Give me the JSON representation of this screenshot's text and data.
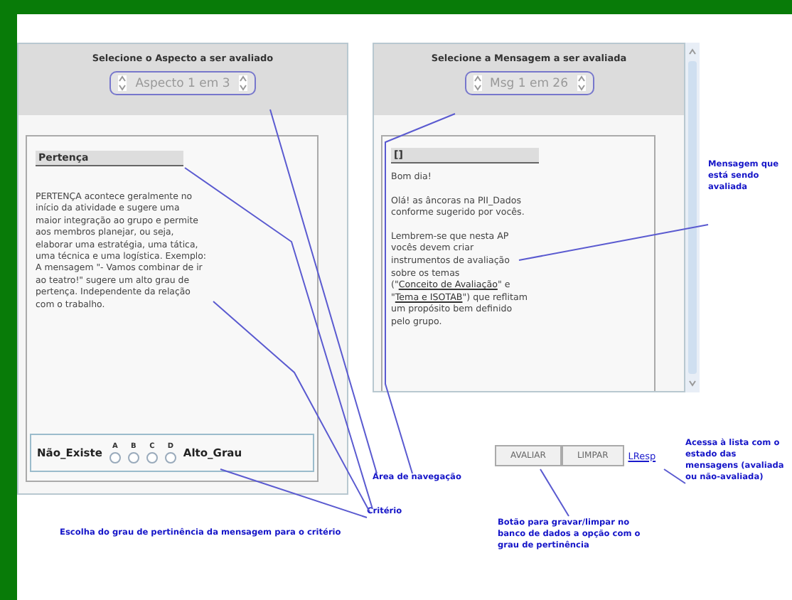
{
  "aspect_panel": {
    "heading": "Selecione o Aspecto a ser avaliado",
    "spinner": {
      "value": "Aspecto 1 em 3"
    },
    "criterion": {
      "title": "Pertença",
      "description": "PERTENÇA acontece geralmente no início da atividade e sugere uma maior integração ao grupo e permite aos membros planejar, ou seja, elaborar uma estratégia, uma tática, uma técnica e uma logística. Exemplo: A mensagem \"- Vamos combinar de ir ao teatro!\" sugere um alto grau de pertença. Independente da relação com o trabalho."
    },
    "scale": {
      "low_label": "Não_Existe",
      "high_label": "Alto_Grau",
      "options": [
        {
          "label": "A",
          "selected": false
        },
        {
          "label": "B",
          "selected": false
        },
        {
          "label": "C",
          "selected": false
        },
        {
          "label": "D",
          "selected": false
        }
      ]
    }
  },
  "message_panel": {
    "heading": "Selecione a Mensagem a ser avaliada",
    "spinner": {
      "value": "Msg 1 em 26"
    },
    "message": {
      "title": "[]",
      "paragraphs": [
        [
          {
            "text": "Bom dia!",
            "link": false
          }
        ],
        [
          {
            "text": "Olá! as âncoras na PII_Dados conforme sugerido por vocês.",
            "link": false
          }
        ],
        [
          {
            "text": "Lembrem-se que nesta AP vocês devem criar instrumentos de avaliação sobre os temas (\"",
            "link": false
          },
          {
            "text": "Conceito de Avaliação",
            "link": true
          },
          {
            "text": "\" e \"",
            "link": false
          },
          {
            "text": "Tema e ISOTAB",
            "link": true
          },
          {
            "text": "\") que reflitam um propósito bem definido pelo grupo.",
            "link": false
          }
        ]
      ]
    }
  },
  "buttons": [
    "AVALIAR",
    "LIMPAR"
  ],
  "link": "LResp",
  "annotations": [
    {
      "text": "Mensagem que está sendo avaliada"
    },
    {
      "text": "Área de navegação"
    },
    {
      "text": "Critério"
    },
    {
      "text": "Escolha do grau de pertinência da mensagem para o critério"
    },
    {
      "text": "Botão para gravar/limpar no banco de dados a opção com o grau de pertinência"
    },
    {
      "text": "Acessa à lista com o estado das mensagens (avaliada ou não-avaliada)"
    }
  ]
}
